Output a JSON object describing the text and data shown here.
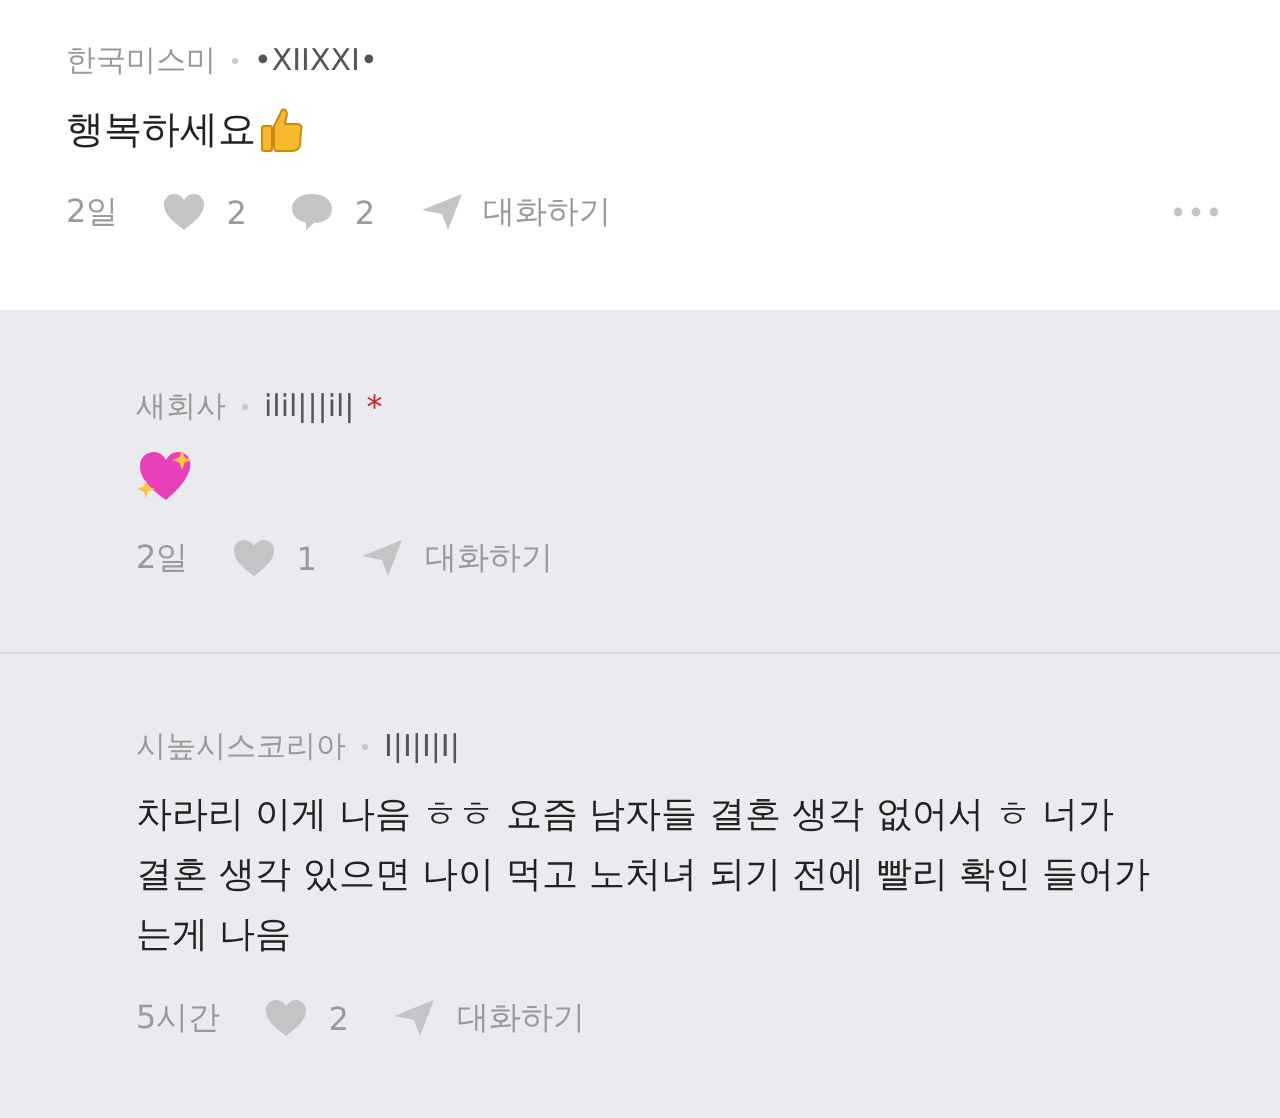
{
  "comments": [
    {
      "kind": "top",
      "author": "한국미스미",
      "nickname": "•XIIXXI•",
      "text": "행복하세요",
      "time": "2일",
      "likes": "2",
      "replies": "2",
      "chat": "대화하기"
    },
    {
      "kind": "reply",
      "author": "새회사",
      "nickname": "ilil|||il|",
      "badge": "*",
      "time": "2일",
      "likes": "1",
      "chat": "대화하기"
    },
    {
      "kind": "reply",
      "author": "시높시스코리아",
      "nickname": "I|I|I|I|",
      "text": "차라리 이게 나음 ㅎㅎ 요즘 남자들 결혼 생각 없어서 ㅎ 너가 결혼 생각 있으면 나이 먹고 노처녀 되기 전에 빨리 확인 들어가는게 나음",
      "time": "5시간",
      "likes": "2",
      "chat": "대화하기"
    }
  ]
}
